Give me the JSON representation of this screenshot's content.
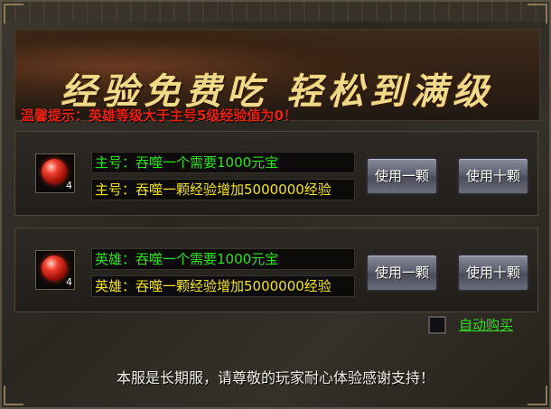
{
  "banner": {
    "title": "经验免费吃  轻松到满级",
    "hint": "温馨提示：英雄等级大于主号5级经验值为0！"
  },
  "rows": [
    {
      "item_qty": "4",
      "cost_text": "主号：吞噬一个需要1000元宝",
      "gain_text": "主号：吞噬一颗经验增加5000000经验",
      "use_one_label": "使用一颗",
      "use_ten_label": "使用十颗"
    },
    {
      "item_qty": "4",
      "cost_text": "英雄：吞噬一个需要1000元宝",
      "gain_text": "英雄：吞噬一颗经验增加5000000经验",
      "use_one_label": "使用一颗",
      "use_ten_label": "使用十颗"
    }
  ],
  "auto_buy": {
    "label": "自动购买",
    "checked": false
  },
  "footer": "本服是长期服，请尊敬的玩家耐心体验感谢支持！",
  "colors": {
    "cost_text": "#2ee020",
    "gain_text": "#f2e21e",
    "hint": "#e82010",
    "title": "#f1d98a"
  }
}
